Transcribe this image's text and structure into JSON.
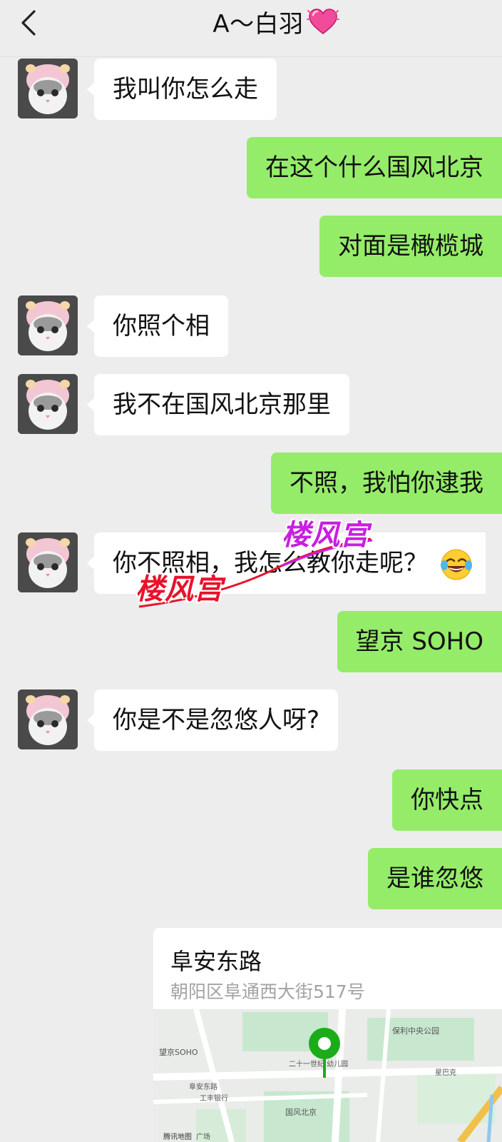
{
  "header": {
    "title": "A～白羽",
    "back_icon": "chevron-left-icon",
    "title_icon": "heart-emoji-icon"
  },
  "messages": [
    {
      "side": "in",
      "text": "我叫你怎么走"
    },
    {
      "side": "out",
      "text": "在这个什么国风北京"
    },
    {
      "side": "out",
      "text": "对面是橄榄城"
    },
    {
      "side": "in",
      "text": "你照个相"
    },
    {
      "side": "in",
      "text": "我不在国风北京那里"
    },
    {
      "side": "out",
      "text": "不照，我怕你逮我"
    },
    {
      "side": "in",
      "text": "你不照相，我怎么教你走呢？",
      "emoji": "laughing-tears-icon"
    },
    {
      "side": "out",
      "text": "望京 SOHO"
    },
    {
      "side": "in",
      "text": "你是不是忽悠人呀?"
    },
    {
      "side": "out",
      "text": "你快点"
    },
    {
      "side": "out",
      "text": "是谁忽悠"
    }
  ],
  "watermark": {
    "text_1": "楼风宫",
    "text_2": "楼风宫"
  },
  "location_card": {
    "name": "阜安东路",
    "address": "朝阳区阜通西大街517号",
    "map_labels": {
      "wangjing_soho": "望京SOHO",
      "baoli": "保利中央公园",
      "kindergarten": "二十一世纪\n幼儿园",
      "guofeng": "国风北京",
      "starbucks": "星巴克",
      "bank": "工丰银行",
      "fuan_east": "阜安东路",
      "guangchang": "广场",
      "tencent_map": "腾讯地图"
    },
    "pin_color": "#1aad19"
  },
  "colors": {
    "background": "#ededed",
    "bubble_in": "#ffffff",
    "bubble_out": "#95ec69",
    "watermark_red": "#e8122a",
    "watermark_purple": "#c81fe0"
  }
}
